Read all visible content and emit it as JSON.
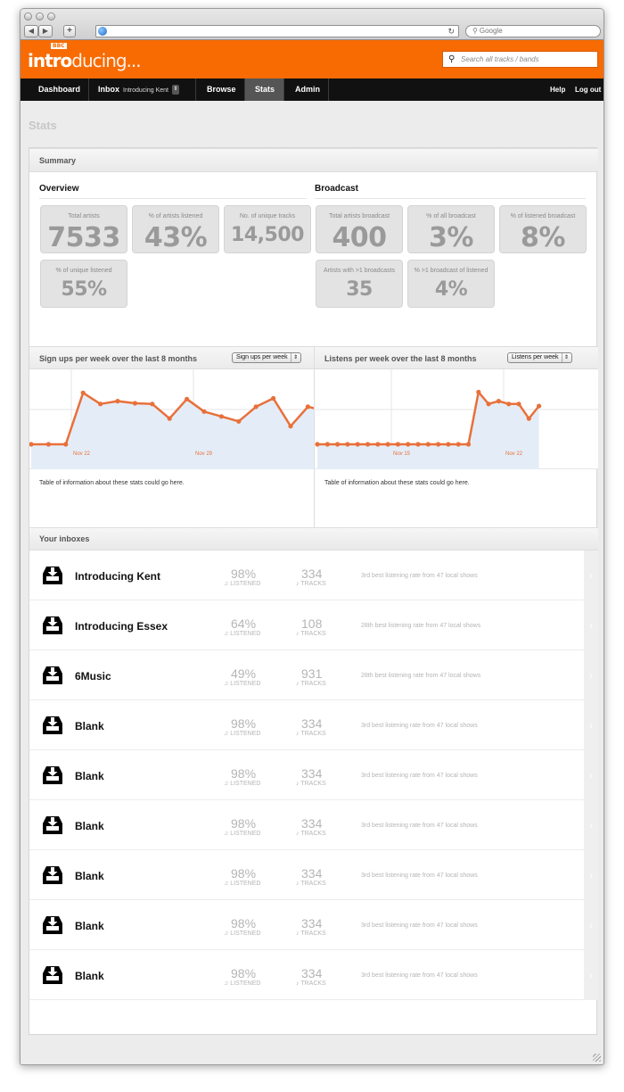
{
  "browser": {
    "search_placeholder": "Google",
    "back_icon": "back-arrow",
    "forward_icon": "forward-arrow",
    "add_label": "+",
    "reload_icon": "reload"
  },
  "brand": {
    "logo_main": "intro",
    "logo_tail": "ducing...",
    "logo_badge": "BBC",
    "accent": "#f76b02"
  },
  "header": {
    "search_placeholder": "Search all tracks / bands"
  },
  "nav": {
    "dashboard": "Dashboard",
    "inbox": "Inbox",
    "inbox_selected": "Introducing Kent",
    "browse": "Browse",
    "stats": "Stats",
    "admin": "Admin",
    "help": "Help",
    "logout": "Log out"
  },
  "page_title": "Stats",
  "summary": {
    "heading": "Summary",
    "overview_heading": "Overview",
    "broadcast_heading": "Broadcast",
    "overview": [
      {
        "label": "Total artists",
        "value": "7533"
      },
      {
        "label": "% of artists listened",
        "value": "43%"
      },
      {
        "label": "No. of unique tracks",
        "value": "14,500"
      },
      {
        "label": "% of unique listened",
        "value": "55%"
      }
    ],
    "broadcast": [
      {
        "label": "Total artists broadcast",
        "value": "400"
      },
      {
        "label": "% of all broadcast",
        "value": "3%"
      },
      {
        "label": "% of listened broadcast",
        "value": "8%"
      },
      {
        "label": "Artists with >1 broadcasts",
        "value": "35"
      },
      {
        "label": "% >1 broadcast of listened",
        "value": "4%"
      }
    ]
  },
  "charts": {
    "signups": {
      "title": "Sign ups per week over the last 8 months",
      "dropdown": "Sign ups per week",
      "note": "Table of information about these stats could go here."
    },
    "listens": {
      "title": "Listens per week over the last 8 months",
      "dropdown": "Listens per week",
      "note": "Table of information about these stats could go here."
    }
  },
  "chart_data": [
    {
      "type": "area",
      "title": "Sign ups per week over the last 8 months",
      "x_tick_labels": [
        "Nov 22",
        "Nov 29"
      ],
      "series": [
        {
          "values": [
            0,
            0,
            0,
            0.74,
            0.58,
            0.62,
            0.59,
            0.58,
            0.37,
            0.65,
            0.47,
            0.4,
            0.33,
            0.54,
            0.66,
            0.26,
            0.54,
            0.48
          ]
        }
      ],
      "ylim": [
        0,
        1
      ],
      "line_color": "#e8703a",
      "fill_color": "#e4edf7",
      "grid": true
    },
    {
      "type": "area",
      "title": "Listens per week over the last 8 months",
      "x_tick_labels": [
        "Nov 15",
        "Nov 22"
      ],
      "series": [
        {
          "values": [
            0,
            0,
            0,
            0,
            0,
            0,
            0,
            0,
            0,
            0,
            0,
            0,
            0,
            0,
            0,
            0,
            0.75,
            0.58,
            0.62,
            0.58,
            0.58,
            0.37,
            0.55
          ]
        }
      ],
      "ylim": [
        0,
        1
      ],
      "line_color": "#e8703a",
      "fill_color": "#e4edf7",
      "grid": true
    }
  ],
  "inboxes": {
    "heading": "Your inboxes",
    "listened_label": "LISTENED",
    "tracks_label": "TRACKS",
    "items": [
      {
        "name": "Introducing Kent",
        "listened": "98%",
        "tracks": "334",
        "desc": "3rd best listening rate from 47 local shows"
      },
      {
        "name": "Introducing Essex",
        "listened": "64%",
        "tracks": "108",
        "desc": "28th best listening rate from 47 local shows"
      },
      {
        "name": "6Music",
        "listened": "49%",
        "tracks": "931",
        "desc": "28th best listening rate from 47 local shows"
      },
      {
        "name": "Blank",
        "listened": "98%",
        "tracks": "334",
        "desc": "3rd best listening rate from 47 local shows"
      },
      {
        "name": "Blank",
        "listened": "98%",
        "tracks": "334",
        "desc": "3rd best listening rate from 47 local shows"
      },
      {
        "name": "Blank",
        "listened": "98%",
        "tracks": "334",
        "desc": "3rd best listening rate from 47 local shows"
      },
      {
        "name": "Blank",
        "listened": "98%",
        "tracks": "334",
        "desc": "3rd best listening rate from 47 local shows"
      },
      {
        "name": "Blank",
        "listened": "98%",
        "tracks": "334",
        "desc": "3rd best listening rate from 47 local shows"
      },
      {
        "name": "Blank",
        "listened": "98%",
        "tracks": "334",
        "desc": "3rd best listening rate from 47 local shows"
      }
    ]
  }
}
